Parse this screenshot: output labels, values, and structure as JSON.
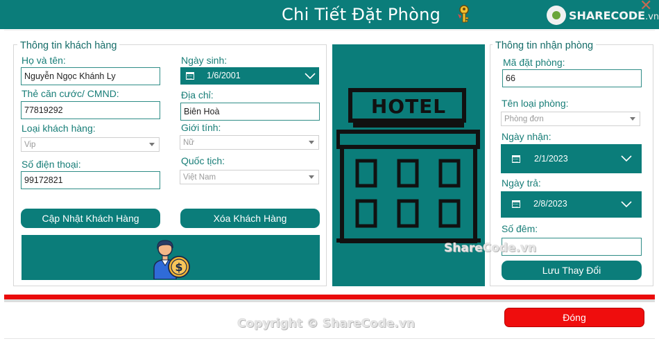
{
  "window": {
    "title": "Chi Tiết Đặt Phòng",
    "logo_text": "SHARECODE",
    "logo_suffix": ".vn",
    "close_glyph": "✕"
  },
  "customer": {
    "group_title": "Thông tin khách hàng",
    "name_label": "Họ và tên:",
    "name_value": "Nguyễn Ngọc Khánh Ly",
    "id_label": "Thẻ căn cước/ CMND:",
    "id_value": "77819292",
    "type_label": "Loại khách hàng:",
    "type_value": "Vip",
    "phone_label": "Số điện thoại:",
    "phone_value": "99172821",
    "dob_label": "Ngày sinh:",
    "dob_value": "1/6/2001",
    "address_label": "Địa chỉ:",
    "address_value": "Biên Hoà",
    "gender_label": "Giới tính:",
    "gender_value": "Nữ",
    "nationality_label": "Quốc tịch:",
    "nationality_value": "Việt Nam",
    "update_button": "Cập Nhật Khách Hàng",
    "delete_button": "Xóa Khách Hàng"
  },
  "hotel_image": {
    "sign_text": "HOTEL"
  },
  "checkin": {
    "group_title": "Thông tin nhận phòng",
    "booking_id_label": "Mã đặt phòng:",
    "booking_id_value": "66",
    "room_type_label": "Tên loại phòng:",
    "room_type_value": "Phòng đơn",
    "checkin_label": "Ngày nhận:",
    "checkin_value": "2/1/2023",
    "checkout_label": "Ngày trả:",
    "checkout_value": "2/8/2023",
    "nights_label": "Số đêm:",
    "nights_value": "",
    "save_button": "Lưu Thay Đổi"
  },
  "footer": {
    "close_button": "Đóng",
    "copyright": "Copyright © ShareCode.vn",
    "watermark_mid": "ShareCode.vn"
  },
  "colors": {
    "primary": "#0b7d7a",
    "danger": "#ef0d0d",
    "label": "#177d77"
  },
  "icons": [
    "calendar-icon",
    "chevron-down-icon",
    "key-icon",
    "customer-money-icon",
    "hotel-building-icon",
    "close-icon"
  ]
}
